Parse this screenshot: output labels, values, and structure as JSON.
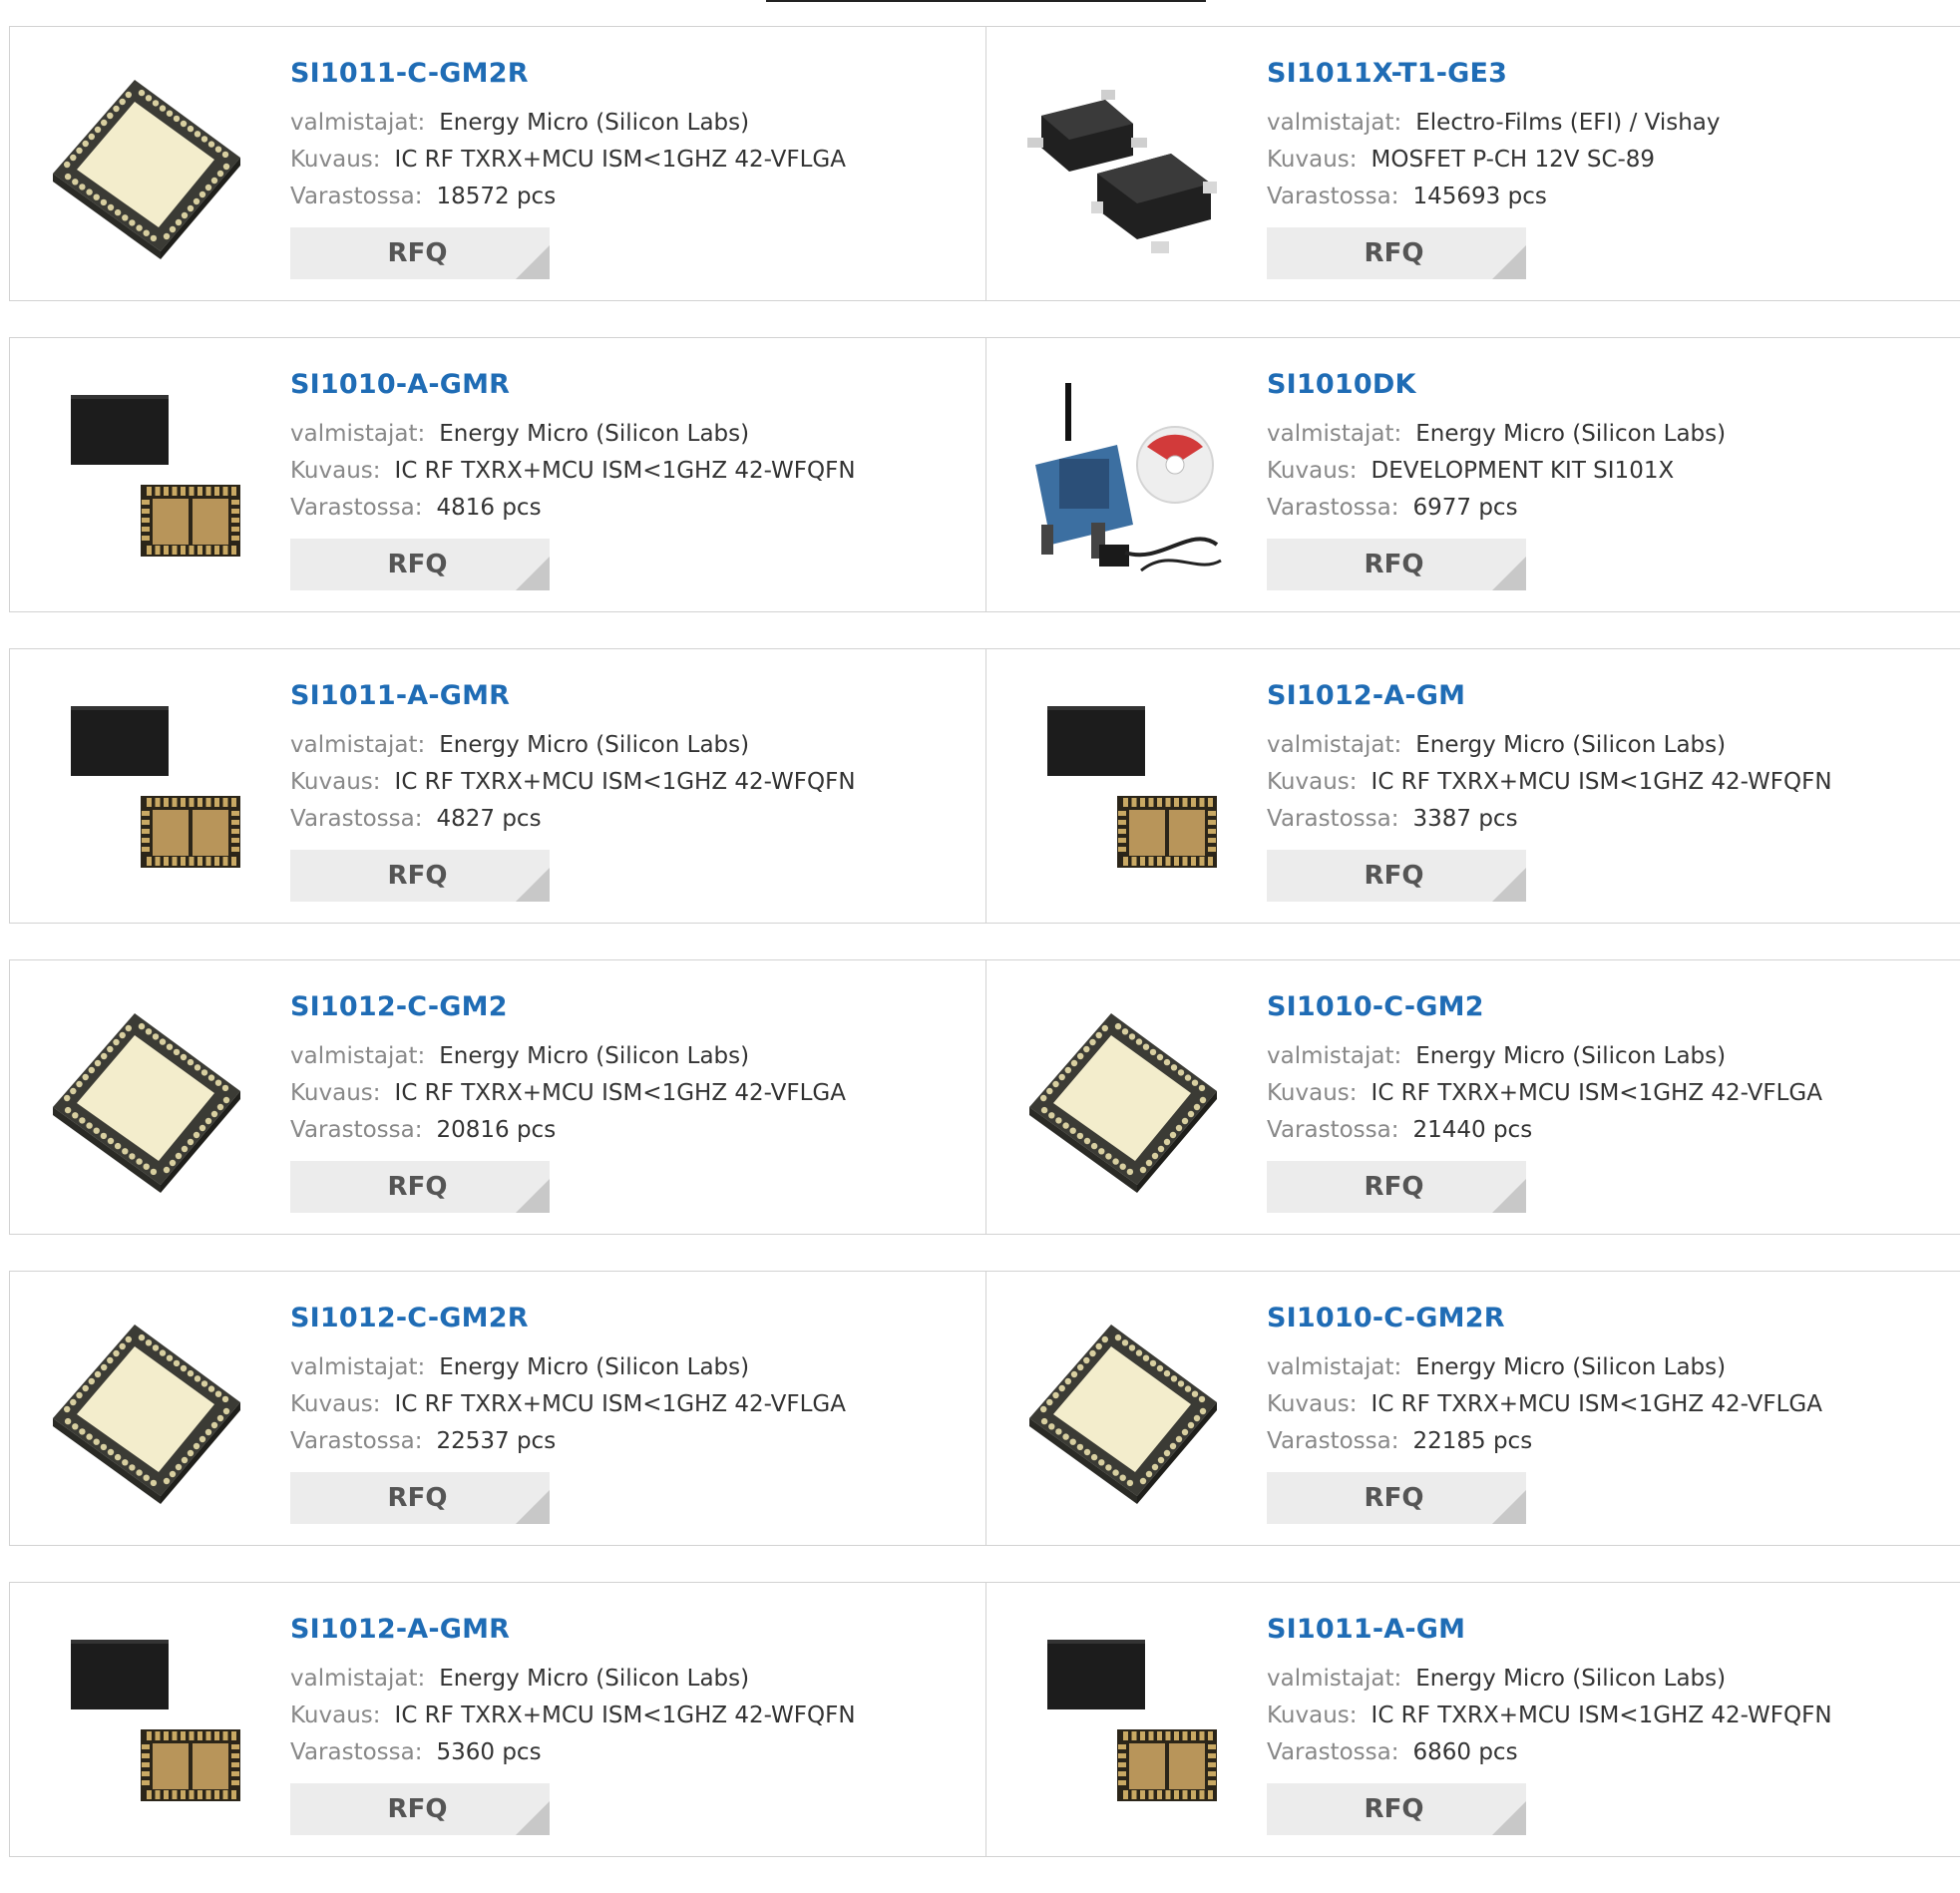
{
  "labels": {
    "manufacturer": "valmistajat:",
    "description": "Kuvaus:",
    "stock": "Varastossa:",
    "rfq": "RFQ"
  },
  "rows": [
    [
      {
        "part": "SI1011-C-GM2R",
        "manufacturer": "Energy Micro (Silicon Labs)",
        "description": "IC RF TXRX+MCU ISM<1GHZ 42-VFLGA",
        "stock": "18572 pcs",
        "image": "vflga-chip-icon"
      },
      {
        "part": "SI1011X-T1-GE3",
        "manufacturer": "Electro-Films (EFI) / Vishay",
        "description": "MOSFET P-CH 12V SC-89",
        "stock": "145693 pcs",
        "image": "sc89-transistor-icon"
      }
    ],
    [
      {
        "part": "SI1010-A-GMR",
        "manufacturer": "Energy Micro (Silicon Labs)",
        "description": "IC RF TXRX+MCU ISM<1GHZ 42-WFQFN",
        "stock": "4816 pcs",
        "image": "wfqfn-chip-icon"
      },
      {
        "part": "SI1010DK",
        "manufacturer": "Energy Micro (Silicon Labs)",
        "description": "DEVELOPMENT KIT SI101X",
        "stock": "6977 pcs",
        "image": "dev-kit-icon"
      }
    ],
    [
      {
        "part": "SI1011-A-GMR",
        "manufacturer": "Energy Micro (Silicon Labs)",
        "description": "IC RF TXRX+MCU ISM<1GHZ 42-WFQFN",
        "stock": "4827 pcs",
        "image": "wfqfn-chip-icon"
      },
      {
        "part": "SI1012-A-GM",
        "manufacturer": "Energy Micro (Silicon Labs)",
        "description": "IC RF TXRX+MCU ISM<1GHZ 42-WFQFN",
        "stock": "3387 pcs",
        "image": "wfqfn-chip-icon"
      }
    ],
    [
      {
        "part": "SI1012-C-GM2",
        "manufacturer": "Energy Micro (Silicon Labs)",
        "description": "IC RF TXRX+MCU ISM<1GHZ 42-VFLGA",
        "stock": "20816 pcs",
        "image": "vflga-chip-icon"
      },
      {
        "part": "SI1010-C-GM2",
        "manufacturer": "Energy Micro (Silicon Labs)",
        "description": "IC RF TXRX+MCU ISM<1GHZ 42-VFLGA",
        "stock": "21440 pcs",
        "image": "vflga-chip-icon"
      }
    ],
    [
      {
        "part": "SI1012-C-GM2R",
        "manufacturer": "Energy Micro (Silicon Labs)",
        "description": "IC RF TXRX+MCU ISM<1GHZ 42-VFLGA",
        "stock": "22537 pcs",
        "image": "vflga-chip-icon"
      },
      {
        "part": "SI1010-C-GM2R",
        "manufacturer": "Energy Micro (Silicon Labs)",
        "description": "IC RF TXRX+MCU ISM<1GHZ 42-VFLGA",
        "stock": "22185 pcs",
        "image": "vflga-chip-icon"
      }
    ],
    [
      {
        "part": "SI1012-A-GMR",
        "manufacturer": "Energy Micro (Silicon Labs)",
        "description": "IC RF TXRX+MCU ISM<1GHZ 42-WFQFN",
        "stock": "5360 pcs",
        "image": "wfqfn-chip-icon"
      },
      {
        "part": "SI1011-A-GM",
        "manufacturer": "Energy Micro (Silicon Labs)",
        "description": "IC RF TXRX+MCU ISM<1GHZ 42-WFQFN",
        "stock": "6860 pcs",
        "image": "wfqfn-chip-icon"
      }
    ]
  ],
  "colors": {
    "part_link": "#1f6cb5",
    "label": "#888888",
    "value": "#333333",
    "border": "#d2d2d2",
    "rfq_bg": "#ececec"
  }
}
